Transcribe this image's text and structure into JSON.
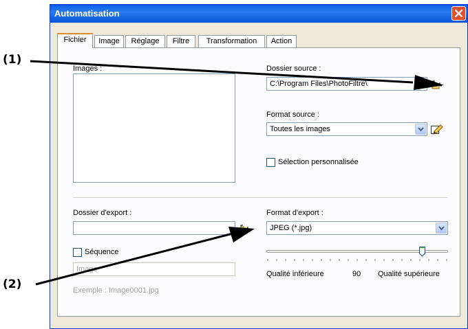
{
  "window": {
    "title": "Automatisation"
  },
  "tabs": [
    {
      "label": "Fichier",
      "active": true
    },
    {
      "label": "Image",
      "active": false
    },
    {
      "label": "Réglage",
      "active": false
    },
    {
      "label": "Filtre",
      "active": false
    },
    {
      "label": "Transformation",
      "active": false
    },
    {
      "label": "Action",
      "active": false
    }
  ],
  "fichier": {
    "images_label": "Images :",
    "dossier_source_label": "Dossier source :",
    "dossier_source_value": "C:\\Program Files\\PhotoFiltre\\",
    "format_source_label": "Format source :",
    "format_source_value": "Toutes les images",
    "selection_label": "Sélection personnalisée",
    "selection_checked": false,
    "dossier_export_label": "Dossier d'export :",
    "dossier_export_value": "",
    "format_export_label": "Format d'export :",
    "format_export_value": "JPEG (*.jpg)",
    "sequence_label": "Séquence",
    "sequence_checked": false,
    "sequence_placeholder": "Image",
    "example_text": "Exemple : Image0001.jpg",
    "quality_low_label": "Qualité inférieure",
    "quality_value": "90",
    "quality_high_label": "Qualité supérieure",
    "quality_fraction": 0.87
  },
  "callouts": {
    "one": "(1)",
    "two": "(2)"
  },
  "colors": {
    "title_bar": "#0a5ee8",
    "active_tab_accent": "#e68b2c",
    "close_button": "#e0502c"
  },
  "icons": {
    "browse_source": "folder-browse-icon",
    "edit_format": "edit-pencil-icon",
    "browse_export": "folder-browse-icon",
    "close": "close-icon"
  }
}
